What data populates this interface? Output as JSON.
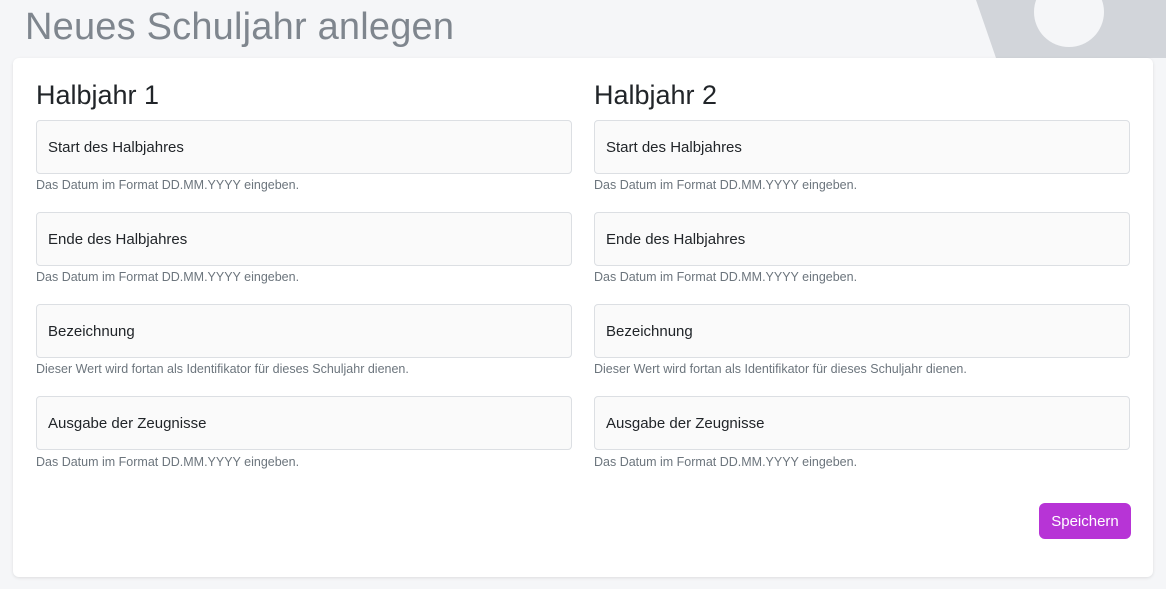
{
  "page": {
    "title": "Neues Schuljahr anlegen"
  },
  "colors": {
    "accent": "#b734d6",
    "title": "#7f868e",
    "help_text": "#6c757d"
  },
  "halbjahr1": {
    "title": "Halbjahr 1",
    "fields": [
      {
        "placeholder": "Start des Halbjahres",
        "help": "Das Datum im Format DD.MM.YYYY eingeben."
      },
      {
        "placeholder": "Ende des Halbjahres",
        "help": "Das Datum im Format DD.MM.YYYY eingeben."
      },
      {
        "placeholder": "Bezeichnung",
        "help": "Dieser Wert wird fortan als Identifikator für dieses Schuljahr dienen."
      },
      {
        "placeholder": "Ausgabe der Zeugnisse",
        "help": "Das Datum im Format DD.MM.YYYY eingeben."
      }
    ]
  },
  "halbjahr2": {
    "title": "Halbjahr 2",
    "fields": [
      {
        "placeholder": "Start des Halbjahres",
        "help": "Das Datum im Format DD.MM.YYYY eingeben."
      },
      {
        "placeholder": "Ende des Halbjahres",
        "help": "Das Datum im Format DD.MM.YYYY eingeben."
      },
      {
        "placeholder": "Bezeichnung",
        "help": "Dieser Wert wird fortan als Identifikator für dieses Schuljahr dienen."
      },
      {
        "placeholder": "Ausgabe der Zeugnisse",
        "help": "Das Datum im Format DD.MM.YYYY eingeben."
      }
    ]
  },
  "actions": {
    "save_label": "Speichern",
    "background_icon": "gear-icon"
  }
}
